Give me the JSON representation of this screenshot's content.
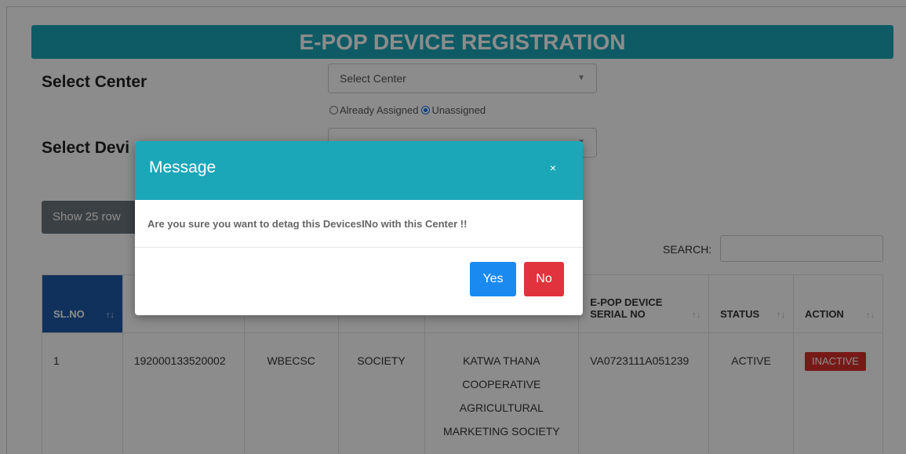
{
  "page": {
    "title": "E-POP DEVICE REGISTRATION"
  },
  "form": {
    "select_center_label": "Select Center",
    "select_center_value": "Select Center",
    "radio_options": [
      {
        "label": "Already Assigned",
        "checked": false
      },
      {
        "label": "Unassigned",
        "checked": true
      }
    ],
    "select_device_label": "Select Devi",
    "select_device_value": ""
  },
  "table_controls": {
    "show_rows_label": "Show 25 row",
    "search_label": "SEARCH:",
    "search_value": ""
  },
  "table": {
    "headers": [
      {
        "label": "SL.NO",
        "sort_icon": "↑↓"
      },
      {
        "label": "",
        "sort_icon": ""
      },
      {
        "label": "",
        "sort_icon": ""
      },
      {
        "label": "",
        "sort_icon": ""
      },
      {
        "label": "",
        "sort_icon": ""
      },
      {
        "label": "E-POP DEVICE SERIAL NO",
        "sort_icon": "↑↓"
      },
      {
        "label": "STATUS",
        "sort_icon": "↑↓"
      },
      {
        "label": "ACTION",
        "sort_icon": "↑↓"
      }
    ],
    "rows": [
      {
        "sl_no": "1",
        "code": "192000133520002",
        "name": "WBECSC",
        "type": "SOCIETY",
        "center_name": "KATWA THANA COOPERATIVE AGRICULTURAL MARKETING SOCIETY",
        "serial_no": "VA0723111A051239",
        "status": "ACTIVE",
        "action": "INACTIVE"
      }
    ]
  },
  "modal": {
    "title": "Message",
    "close_symbol": "×",
    "message": "Are you sure you want to detag this DevicesINo with this Center !!",
    "yes_label": "Yes",
    "no_label": "No"
  },
  "colors": {
    "brand_teal": "#1ba7b8",
    "header_blue": "#1e5aa8",
    "yes_blue": "#1a8af0",
    "no_red": "#e0333d",
    "inactive_red": "#d9302b"
  }
}
